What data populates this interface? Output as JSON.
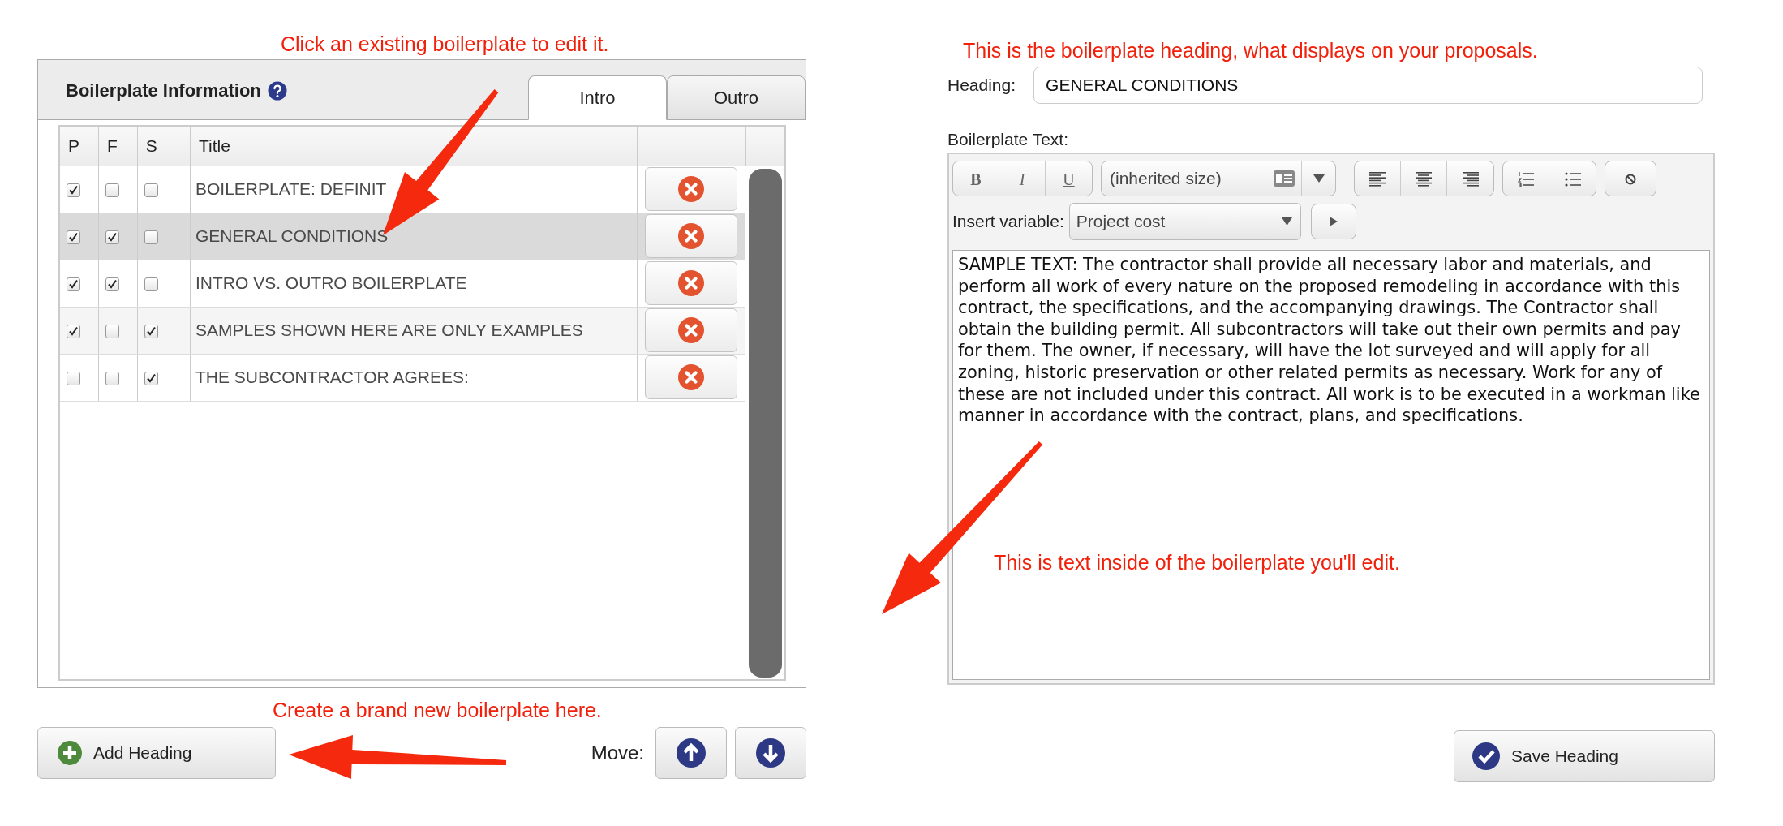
{
  "notes": {
    "list": "Click an existing boilerplate to edit it.",
    "add": "Create a brand new boilerplate here.",
    "heading": "This is the boilerplate heading, what displays on your proposals.",
    "text": "This is text inside of the boilerplate you'll edit."
  },
  "panel": {
    "title": "Boilerplate Information",
    "tabs": [
      {
        "label": "Intro",
        "selected": true
      },
      {
        "label": "Outro",
        "selected": false
      }
    ],
    "columns": [
      "P",
      "F",
      "S",
      "Title"
    ],
    "rows": [
      {
        "p": true,
        "f": false,
        "s": false,
        "title": "BOILERPLATE: DEFINIT",
        "selected": false
      },
      {
        "p": true,
        "f": true,
        "s": false,
        "title": "GENERAL CONDITIONS",
        "selected": true
      },
      {
        "p": true,
        "f": true,
        "s": false,
        "title": "INTRO VS. OUTRO BOILERPLATE",
        "selected": false
      },
      {
        "p": true,
        "f": false,
        "s": true,
        "title": "SAMPLES SHOWN HERE ARE ONLY EXAMPLES",
        "selected": false
      },
      {
        "p": false,
        "f": false,
        "s": true,
        "title": "THE SUBCONTRACTOR AGREES:",
        "selected": false
      }
    ]
  },
  "add_button": "Add Heading",
  "move_label": "Move:",
  "editor": {
    "heading_label": "Heading:",
    "heading_value": "GENERAL CONDITIONS",
    "text_label": "Boilerplate Text:",
    "format": [
      "B",
      "I",
      "U"
    ],
    "size": "(inherited size)",
    "variable_label": "Insert variable:",
    "variable_value": "Project cost",
    "body": "SAMPLE TEXT: The contractor shall provide all necessary labor and materials, and perform all work of every nature on the proposed remodeling in accordance with this contract, the specifications, and the accompanying drawings. The Contractor shall obtain the building permit. All subcontractors will take out their own permits and pay for them. The owner, if necessary, will have the lot surveyed and will apply for all zoning, historic preservation or other related permits as necessary. Work for any of these are not included under this contract. All work is to be executed in a workman like manner in accordance with the contract, plans, and specifications."
  },
  "save_button": "Save Heading"
}
